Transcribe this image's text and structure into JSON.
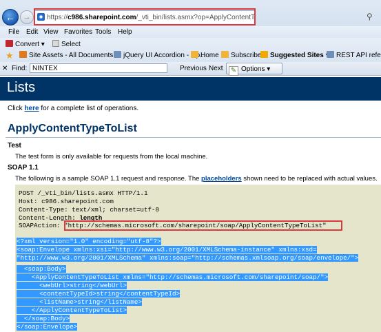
{
  "browser": {
    "address_prefix": "https://",
    "address_host": "c986.sharepoint.com",
    "address_path": "/_vti_bin/lists.asmx?op=ApplyContentTypeToList",
    "menu": [
      "File",
      "Edit",
      "View",
      "Favorites",
      "Tools",
      "Help"
    ],
    "convert_label": "Convert",
    "select_label": "Select",
    "favorites": [
      {
        "label": "Site Assets - All Documents",
        "icon": "sharepoint-icon",
        "color": "#e07a1f"
      },
      {
        "label": "jQuery UI Accordion - Op...",
        "icon": "page-icon",
        "color": "#6d8fb8"
      },
      {
        "label": "Home",
        "icon": "folder-icon",
        "color": "#f0b43a"
      },
      {
        "label": "Subscribe",
        "icon": "folder-icon",
        "color": "#f0b43a"
      },
      {
        "label": "Suggested Sites",
        "icon": "bing-icon",
        "color": "#f2a900"
      },
      {
        "label": "REST API reference",
        "icon": "page-icon",
        "color": "#6d8fb8"
      }
    ],
    "find_label": "Find:",
    "find_value": "NINTEX",
    "previous_label": "Previous",
    "next_label": "Next",
    "options_label": "Options"
  },
  "page": {
    "header_title": "Lists",
    "intro_before": "Click ",
    "intro_link": "here",
    "intro_after": " for a complete list of operations.",
    "operation_title": "ApplyContentTypeToList",
    "test_heading": "Test",
    "test_desc": "The test form is only available for requests from the local machine.",
    "soap_heading": "SOAP 1.1",
    "soap_desc_before": "The following is a sample SOAP 1.1 request and response. The ",
    "soap_desc_link": "placeholders",
    "soap_desc_after": " shown need to be replaced with actual values.",
    "request_lines": [
      "POST /_vti_bin/lists.asmx HTTP/1.1",
      "Host: c986.sharepoint.com",
      "Content-Type: text/xml; charset=utf-8",
      "Content-Length: ",
      "SOAPAction: "
    ],
    "content_length_placeholder": "length",
    "soap_action_value": "\"http://schemas.microsoft.com/sharepoint/soap/ApplyContentTypeToList\"",
    "xml_lines": [
      "<?xml version=\"1.0\" encoding=\"utf-8\"?>",
      "<soap:Envelope xmlns:xsi=\"http://www.w3.org/2001/XMLSchema-instance\" xmlns:xsd=",
      "\"http://www.w3.org/2001/XMLSchema\" xmlns:soap=\"http://schemas.xmlsoap.org/soap/envelope/\">",
      "  <soap:Body>",
      "    <ApplyContentTypeToList xmlns=\"http://schemas.microsoft.com/sharepoint/soap/\">",
      "      <webUrl>string</webUrl>",
      "      <contentTypeId>string</contentTypeId>",
      "      <listName>string</listName>",
      "    </ApplyContentTypeToList>",
      "  </soap:Body>",
      "</soap:Envelope>"
    ]
  },
  "colors": {
    "header_bg": "#003366",
    "highlight_border": "#d9393f",
    "selection": "#3399ff",
    "code_bg": "#e5e5cc"
  }
}
